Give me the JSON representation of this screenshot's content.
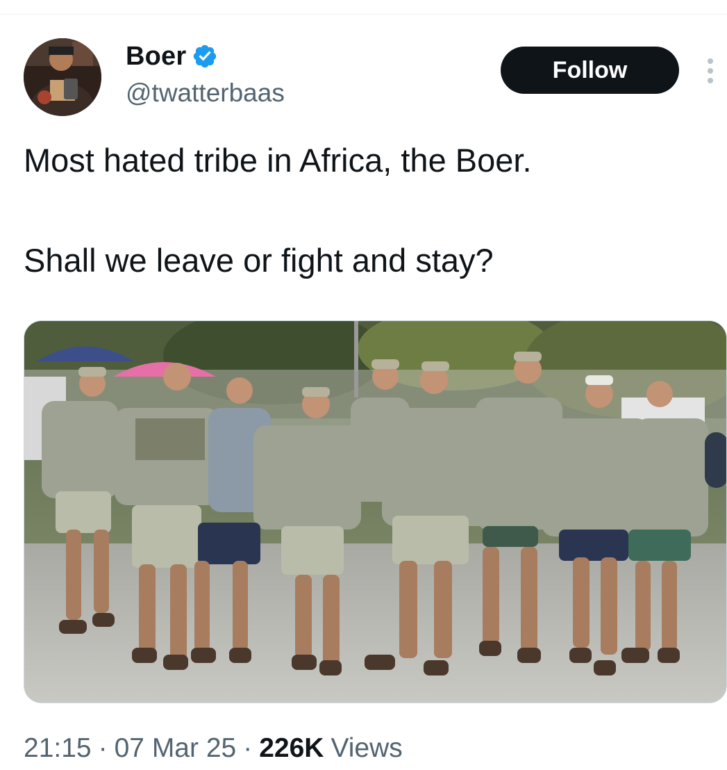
{
  "author": {
    "display_name": "Boer",
    "handle": "@twatterbaas",
    "verified": true,
    "avatar_icon": "profile-photo"
  },
  "actions": {
    "follow_label": "Follow",
    "more_icon": "more-vertical-icon"
  },
  "tweet": {
    "line1": "Most hated tribe in Africa, the Boer.",
    "line2": "Shall we leave or fight and stay?"
  },
  "media": {
    "alt": ""
  },
  "meta": {
    "time": "21:15",
    "separator": "·",
    "date": "07 Mar 25",
    "views_count": "226K",
    "views_label": "Views"
  },
  "colors": {
    "accent": "#1d9bf0",
    "text_primary": "#0f1419",
    "text_secondary": "#536471",
    "button_bg": "#0f1419"
  }
}
